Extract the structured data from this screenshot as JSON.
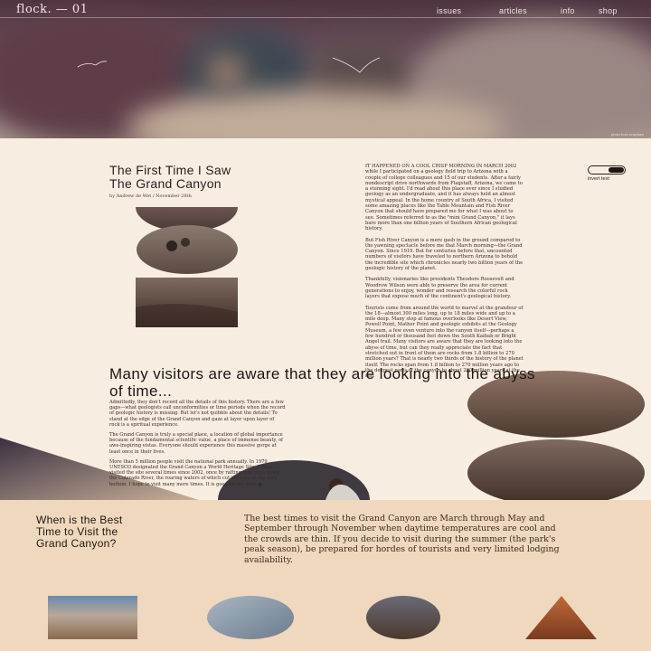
{
  "nav": {
    "logo": "flock. — 01",
    "links": [
      "issues",
      "articles",
      "info",
      "shop"
    ]
  },
  "hero": {
    "credit": "photo from unsplash"
  },
  "article": {
    "title_line1": "The First Time I Saw",
    "title_line2": "The Grand Canyon",
    "byline": "by Andrew de Wet / November 28th",
    "intro_paragraphs": [
      "IT HAPPENED ON A COOL CRISP MORNING IN MARCH 2002 while I participated on a geology field trip to Arizona with a couple of college colleagues and 15 of our students. After a fairly nondescript drive northwards from Flagstaff, Arizona, we came to a stunning sight. I'd read about this place ever since I studied geology as an undergraduate, and it has always held an almost mystical appeal. In the home country of South Africa, I visited some amazing places like the Table Mountain and Fish River Canyon that should have prepared me for what I was about to see. Sometimes referred to as the \"mini Grand Canyon,\" it lays bare more than one billion years of Southern African geological history.",
      "But Fish River Canyon is a mere gash in the ground compared to the yawning spectacle before me that March morning—the Grand Canyon. Since 1919. But for centuries before that, uncounted numbers of visitors have traveled to northern Arizona to behold the incredible site which chronicles nearly two billion years of the geologic history of the planet.",
      "Thankfully, visionaries like presidents Theodore Roosevelt and Woodrow Wilson were able to preserve the area for current generations to enjoy, wonder and research the colorful rock layers that expose much of the continent's geological history.",
      "Tourists come from around the world to marvel at the grandeur of the 18—almost 300 miles long, up to 18 miles wide and up to a mile deep. Many stop at famous overlooks like Desert View, Powell Point, Mather Point and geologic exhibits at the Geology Museum, a few even venture into the canyon itself—perhaps a few hundred or thousand feet down the South Kaibab or Bright Angel trail. Many visitors are aware that they are looking into the abyss of time, but can they really appreciate the fact that stretched out in front of them are rocks from 1.8 billion to 270 million years? That is nearly two thirds of the history of the planet itself. The rocks span from 1.8 billion to 270 million years ago to the deepest parts of the canyon to about 200 million years at the rim."
    ],
    "toggle_label": "invert text",
    "pull_quote": "Many visitors are aware that they are looking into the abyss of time...",
    "body_paragraphs": [
      "Admittedly, they don't record all the details of this history. There are a few gaps—what geologists call unconformities or time periods when the record of geologic history is missing. But let's not quibble about the details! To stand at the edge of the Grand Canyon and gaze at layer upon layer of rock is a spiritual experience.",
      "The Grand Canyon is truly a special place, a location of global importance because of the fundamental scientific value, a place of immense beauty, of awe-inspiring vistas. Everyone should experience this massive gorge at least once in their lives.",
      "More than 5 million people visit the national park annually. In 1979, UNESCO designated the Grand Canyon a World Heritage Site. I have visited the site several times since 2002, once by rafting nine days down the Colorado River, the roaring waters of which cut the rock at the very bottom. I hope to visit many more times. It is good for my soul. ●"
    ]
  },
  "best_time": {
    "heading_line1": "When is the Best",
    "heading_line2": "Time to Visit the",
    "heading_line3": "Grand Canyon?",
    "description": "The best times to visit the Grand Canyon are March through May and September through November when daytime temperatures are cool and the crowds are thin. If you decide to visit during the summer (the park's peak season), be prepared for hordes of tourists and very limited lodging availability."
  },
  "colors": {
    "page_bg": "#f8ede1",
    "band_bg": "#efd8bd",
    "text_dark": "#1e1612"
  }
}
